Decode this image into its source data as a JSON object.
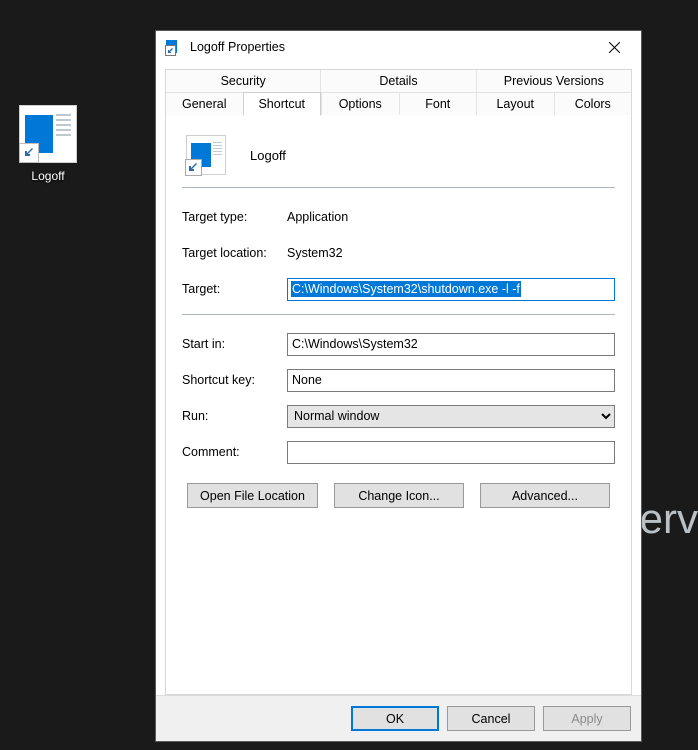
{
  "desktop": {
    "bg_text": "Serv",
    "shortcut_label": "Logoff"
  },
  "dialog": {
    "title": "Logoff Properties",
    "tabs_row1": [
      "Security",
      "Details",
      "Previous Versions"
    ],
    "tabs_row2": [
      "General",
      "Shortcut",
      "Options",
      "Font",
      "Layout",
      "Colors"
    ],
    "active_tab": "Shortcut",
    "shortcut": {
      "name": "Logoff",
      "target_type_label": "Target type:",
      "target_type": "Application",
      "target_location_label": "Target location:",
      "target_location": "System32",
      "target_label": "Target:",
      "target": "C:\\Windows\\System32\\shutdown.exe -l -f",
      "startin_label": "Start in:",
      "startin": "C:\\Windows\\System32",
      "shortcutkey_label": "Shortcut key:",
      "shortcutkey": "None",
      "run_label": "Run:",
      "run": "Normal window",
      "comment_label": "Comment:",
      "comment": ""
    },
    "buttons": {
      "open_file_location": "Open File Location",
      "change_icon": "Change Icon...",
      "advanced": "Advanced..."
    },
    "footer": {
      "ok": "OK",
      "cancel": "Cancel",
      "apply": "Apply"
    }
  }
}
